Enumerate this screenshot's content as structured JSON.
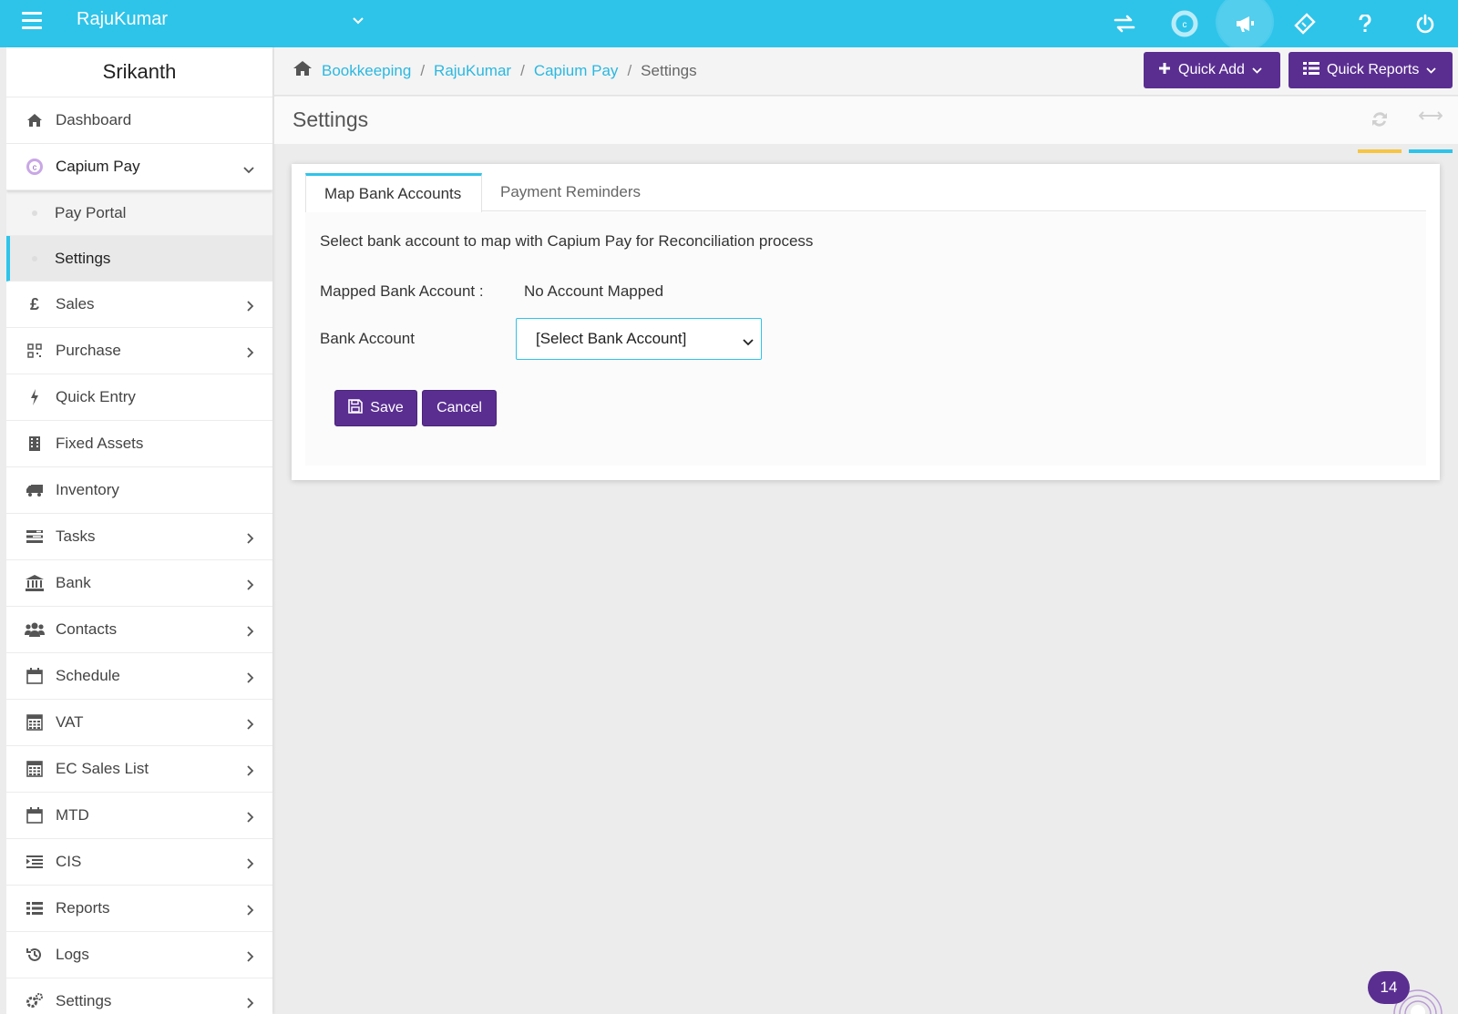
{
  "header": {
    "brand": "RajuKumar",
    "icons": [
      "exchange-icon",
      "capium-logo-icon",
      "megaphone-icon",
      "ticket-icon",
      "help-icon",
      "power-icon"
    ]
  },
  "sidebar": {
    "user": "Srikanth",
    "items": [
      {
        "label": "Dashboard",
        "icon": "home-icon"
      },
      {
        "label": "Capium Pay",
        "icon": "capium-icon",
        "expanded": true
      },
      {
        "label": "Pay Portal",
        "sub": true
      },
      {
        "label": "Settings",
        "sub": true,
        "active": true
      },
      {
        "label": "Sales",
        "icon": "pound-icon"
      },
      {
        "label": "Purchase",
        "icon": "qrcode-icon"
      },
      {
        "label": "Quick Entry",
        "icon": "bolt-icon"
      },
      {
        "label": "Fixed Assets",
        "icon": "building-icon"
      },
      {
        "label": "Inventory",
        "icon": "truck-icon"
      },
      {
        "label": "Tasks",
        "icon": "tasks-icon"
      },
      {
        "label": "Bank",
        "icon": "bank-icon"
      },
      {
        "label": "Contacts",
        "icon": "users-icon"
      },
      {
        "label": "Schedule",
        "icon": "calendar-icon"
      },
      {
        "label": "VAT",
        "icon": "calculator-icon"
      },
      {
        "label": "EC Sales List",
        "icon": "calculator-icon"
      },
      {
        "label": "MTD",
        "icon": "calendar-icon"
      },
      {
        "label": "CIS",
        "icon": "indent-icon"
      },
      {
        "label": "Reports",
        "icon": "list-icon"
      },
      {
        "label": "Logs",
        "icon": "history-icon"
      },
      {
        "label": "Settings",
        "icon": "cogs-icon"
      }
    ]
  },
  "breadcrumb": {
    "items": [
      "Bookkeeping",
      "RajuKumar",
      "Capium Pay"
    ],
    "current": "Settings"
  },
  "toolbar": {
    "quick_add": "Quick Add",
    "quick_reports": "Quick Reports"
  },
  "page": {
    "title": "Settings"
  },
  "tabs": [
    "Map Bank Accounts",
    "Payment Reminders"
  ],
  "form": {
    "description": "Select bank account to map with Capium Pay for Reconciliation process",
    "mapped_label": "Mapped Bank Account :",
    "mapped_value": "No Account Mapped",
    "bank_label": "Bank Account",
    "bank_select": "[Select Bank Account]",
    "save": "Save",
    "cancel": "Cancel"
  },
  "notifications": {
    "count": "14"
  },
  "colors": {
    "topbar": "#2ec4ea",
    "accent_purple": "#5a2e91",
    "link": "#2bb8e0",
    "refresh_bar": "#f6c544",
    "expand_bar": "#2ec4ea"
  }
}
